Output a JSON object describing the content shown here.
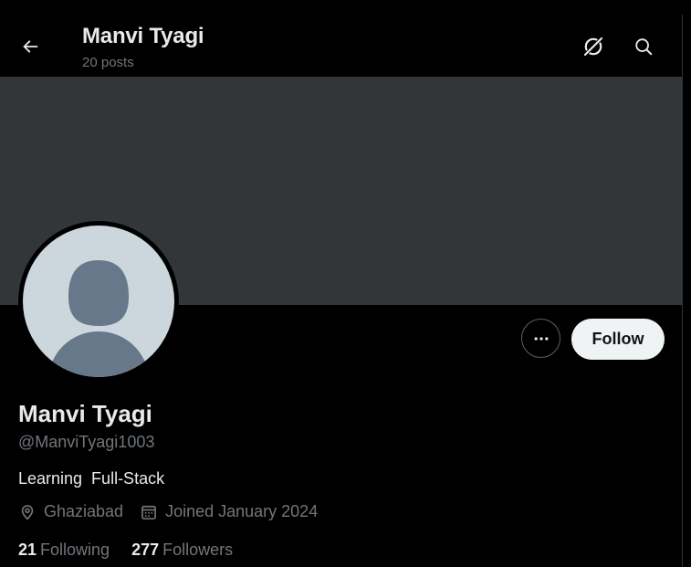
{
  "header": {
    "title": "Manvi Tyagi",
    "post_count": "20 posts",
    "back_icon": "arrow-left-icon",
    "grok_icon": "grok-icon",
    "search_icon": "search-icon"
  },
  "profile": {
    "name": "Manvi Tyagi",
    "handle": "@ManviTyagi1003",
    "bio": "Learning  Full-Stack",
    "location": "Ghaziabad",
    "joined": "Joined January 2024",
    "following_count": "21",
    "following_label": "Following",
    "followers_count": "277",
    "followers_label": "Followers"
  },
  "actions": {
    "follow_label": "Follow",
    "more_icon": "more-horizontal-icon"
  },
  "colors": {
    "background": "#000000",
    "banner": "#333639",
    "avatar_bg": "#ccd6dd",
    "avatar_silhouette": "#66788a",
    "primary_text": "#e7e9ea",
    "secondary_text": "#71767b",
    "follow_button_bg": "#eff3f4"
  }
}
